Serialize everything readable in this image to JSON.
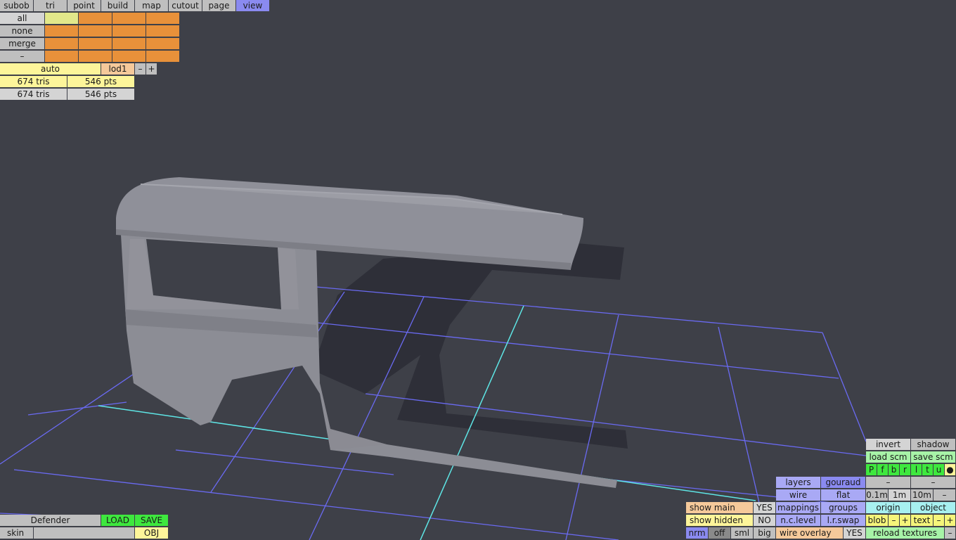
{
  "tabs": [
    "subob",
    "tri",
    "point",
    "build",
    "map",
    "cutout",
    "page",
    "view"
  ],
  "left_panel": {
    "selectors": [
      "all",
      "none",
      "merge",
      "–"
    ],
    "auto_label": "auto",
    "lod_label": "lod1",
    "minus": "–",
    "plus": "+",
    "stats": [
      {
        "tris": "674 tris",
        "pts": "546 pts"
      },
      {
        "tris": "674 tris",
        "pts": "546 pts"
      }
    ]
  },
  "bottom_left": {
    "model_name": "Defender",
    "load_label": "LOAD",
    "save_label": "SAVE",
    "skin_label": "skin",
    "obj_label": "OBJ"
  },
  "bottom_right": {
    "invert": "invert",
    "shadow": "shadow",
    "load_scm": "load scm",
    "save_scm": "save scm",
    "channels": [
      "P",
      "f",
      "b",
      "r",
      "l",
      "t",
      "u",
      "●"
    ],
    "layers": "layers",
    "gouraud": "gouraud",
    "dash1": "–",
    "dash2": "–",
    "wire": "wire",
    "flat": "flat",
    "scale": [
      "0.1m",
      "1m",
      "10m",
      "–"
    ],
    "show_main": "show main",
    "show_main_val": "YES",
    "mappings": "mappings",
    "groups": "groups",
    "origin": "origin",
    "object": "object",
    "show_hidden": "show hidden",
    "show_hidden_val": "NO",
    "nc_level": "n.c.level",
    "lr_swap": "l.r.swap",
    "blob": "blob",
    "blob_minus": "–",
    "blob_plus": "+",
    "text": "text",
    "text_minus": "–",
    "text_plus": "+",
    "nrm": "nrm",
    "off": "off",
    "sml": "sml",
    "big": "big",
    "wire_overlay": "wire overlay",
    "wire_overlay_val": "YES",
    "reload_textures": "reload textures",
    "last_minus": "–"
  },
  "colors": {
    "background": "#3e4048",
    "grid": "#6b6bf0",
    "axis": "#5ee6e6",
    "model": "#8f9098",
    "shadow": "#2c2d36"
  }
}
